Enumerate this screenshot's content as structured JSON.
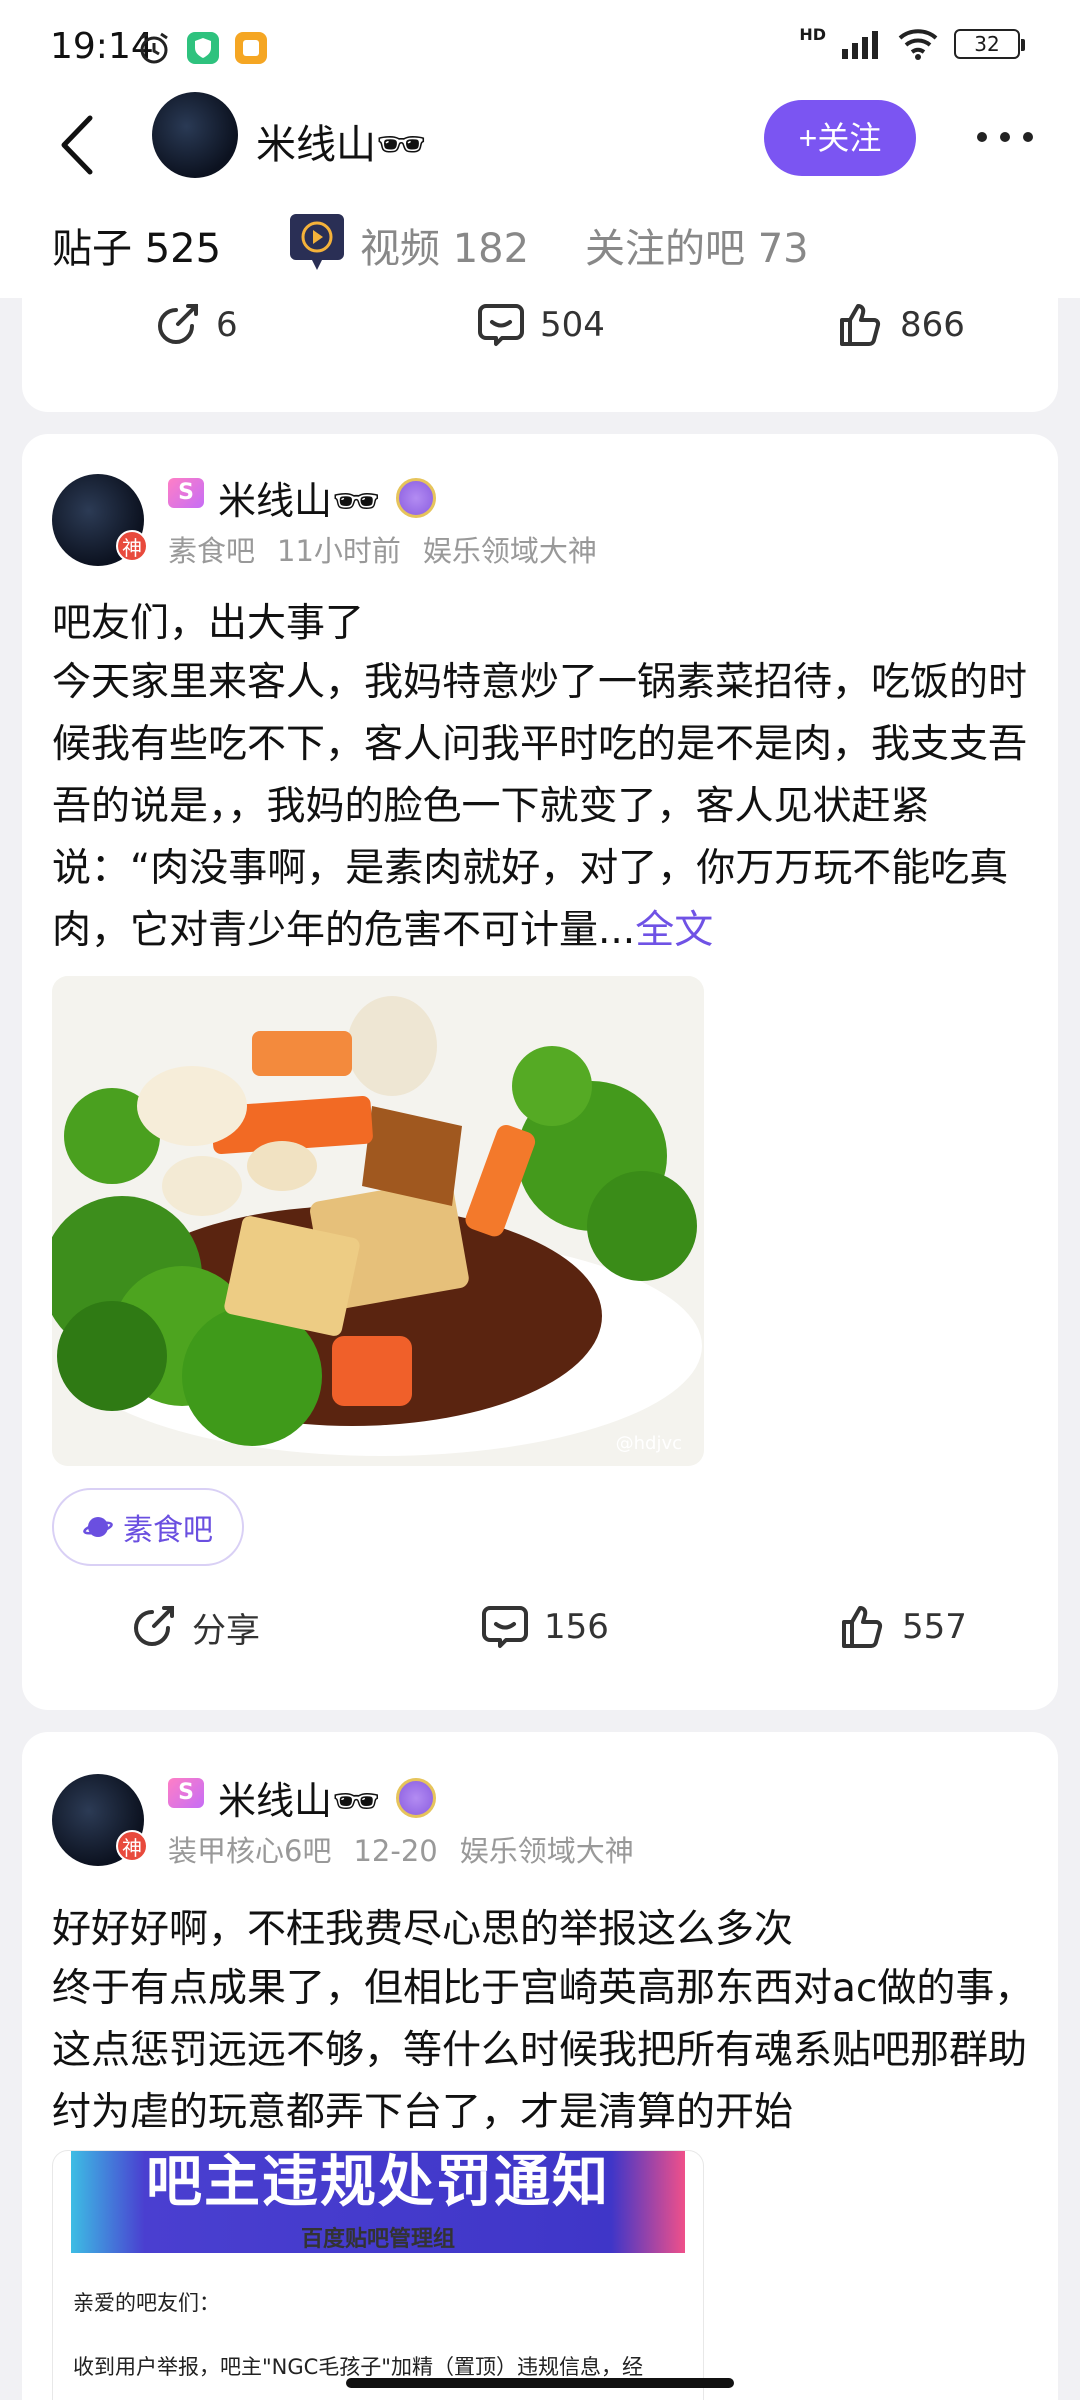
{
  "status_bar": {
    "time": "19:14",
    "battery": "32",
    "network": "HD"
  },
  "header": {
    "user_name": "米线山🕶",
    "follow_label": "+关注"
  },
  "tabs": [
    {
      "label": "贴子 525"
    },
    {
      "label": "视频 182"
    },
    {
      "label": "关注的吧 73"
    }
  ],
  "top_card": {
    "share_count": "6",
    "comment_count": "504",
    "like_count": "866"
  },
  "posts": [
    {
      "author": "米线山🕶",
      "god_badge": "神",
      "vip_badge": "S",
      "bar": "素食吧",
      "time": "11小时前",
      "role": "娱乐领域大神",
      "title": "吧友们，出大事了",
      "body": "今天家里来客人，我妈特意炒了一锅素菜招待，吃饭的时候我有些吃不下，客人问我平时吃的是不是肉，我支支吾吾的说是，，我妈的脸色一下就变了，客人见状赶紧说：“肉没事啊，是素肉就好，对了，你万万玩不能吃真肉，它对青少年的危害不可计量...",
      "more_label": "全文",
      "image_watermark": "@hdjvc",
      "tag": "素食吧",
      "share_label": "分享",
      "comment_count": "156",
      "like_count": "557"
    },
    {
      "author": "米线山🕶",
      "god_badge": "神",
      "vip_badge": "S",
      "bar": "装甲核心6吧",
      "time": "12-20",
      "role": "娱乐领域大神",
      "title": "好好好啊，不枉我费尽心思的举报这么多次",
      "body": "终于有点成果了，但相比于宫崎英高那东西对ac做的事，这点惩罚远远不够，等什么时候我把所有魂系贴吧那群助纣为虐的玩意都弄下台了，才是清算的开始",
      "notice": {
        "banner_title": "吧主违规处罚通知",
        "subtitle": "百度贴吧管理组",
        "greeting": "亲爱的吧友们：",
        "line": "收到用户举报，吧主\"NGC毛孩子\"加精（置顶）违规信息，经"
      }
    }
  ],
  "colors": {
    "accent": "#7b55f2",
    "link": "#6f52e5",
    "background": "#f1f1f4"
  }
}
